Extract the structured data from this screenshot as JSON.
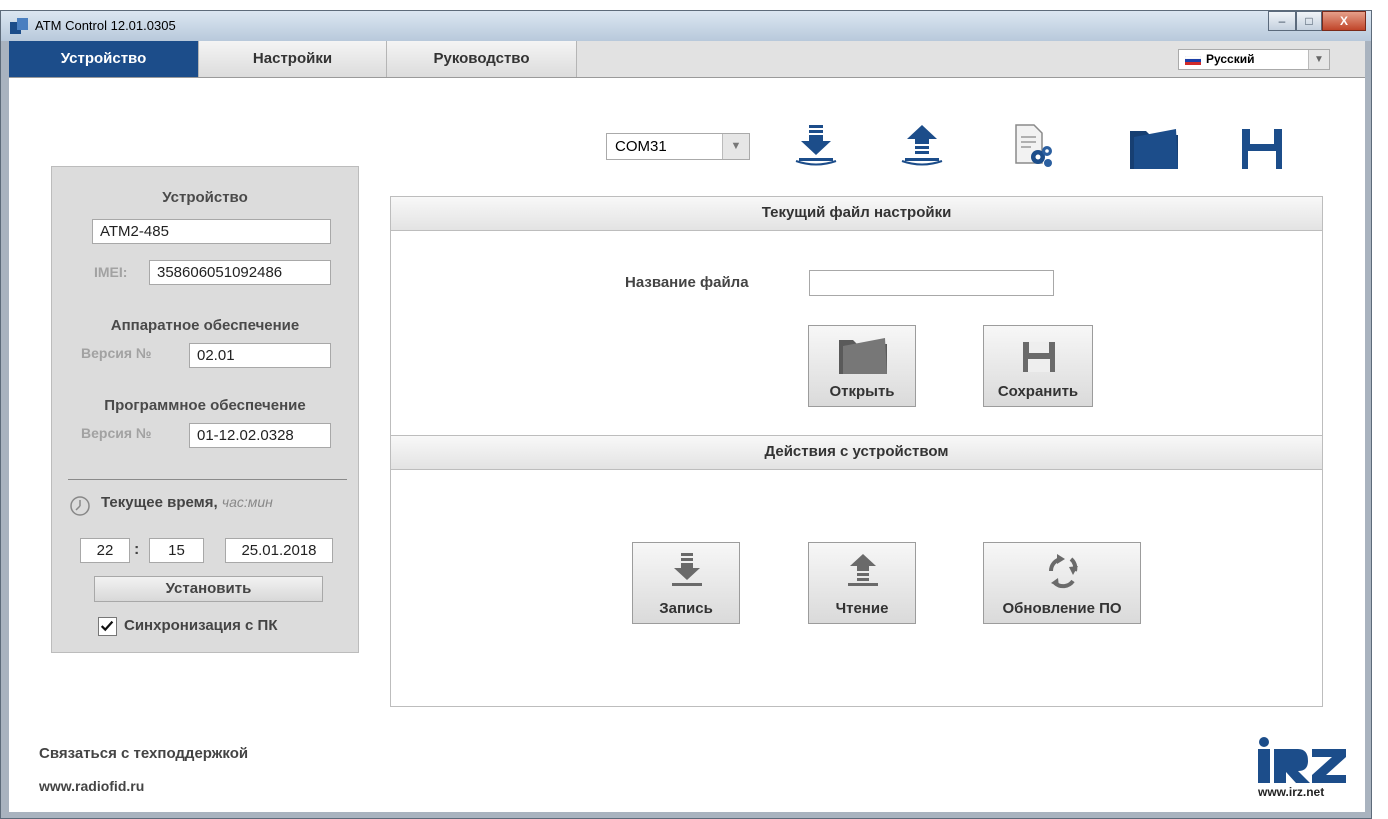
{
  "window": {
    "title": "ATM Control 12.01.0305",
    "controls": {
      "minimize": "–",
      "maximize": "□",
      "close": "X"
    }
  },
  "tabs": [
    {
      "label": "Устройство",
      "active": true
    },
    {
      "label": "Настройки",
      "active": false
    },
    {
      "label": "Руководство",
      "active": false
    }
  ],
  "language": {
    "selected": "Русский",
    "flag_icon": "russia-flag-icon"
  },
  "toolbar": {
    "com_port": "COM31",
    "icons": [
      "write-to-device-icon",
      "read-from-device-icon",
      "file-settings-icon",
      "open-folder-icon",
      "save-disk-icon"
    ]
  },
  "device": {
    "heading": "Устройство",
    "model": "ATM2-485",
    "imei_label": "IMEI:",
    "imei": "358606051092486",
    "hardware_heading": "Аппаратное обеспечение",
    "hardware_version_label": "Версия №",
    "hardware_version": "02.01",
    "software_heading": "Программное обеспечение",
    "software_version_label": "Версия №",
    "software_version": "01-12.02.0328",
    "time_heading": "Текущее время,",
    "time_format": "час:мин",
    "hours": "22",
    "separator": ":",
    "minutes": "15",
    "date": "25.01.2018",
    "set_button": "Установить",
    "sync_label": "Синхронизация с ПК",
    "sync_checked": true
  },
  "settings_file": {
    "heading": "Текущий файл настройки",
    "filename_label": "Название файла",
    "filename_value": "",
    "open_button": "Открыть",
    "save_button": "Сохранить"
  },
  "device_actions": {
    "heading": "Действия с устройством",
    "write_button": "Запись",
    "read_button": "Чтение",
    "update_button": "Обновление ПО"
  },
  "footer": {
    "support_text": "Связаться с техподдержкой",
    "website": "www.radiofid.ru",
    "logo_text": "iRZ",
    "logo_url_text": "www.irz.net"
  },
  "colors": {
    "accent": "#1c4d8a",
    "tab_active_text": "#ffffff",
    "panel_bg": "#dcdcdc",
    "icon_blue": "#1c4d8a"
  }
}
